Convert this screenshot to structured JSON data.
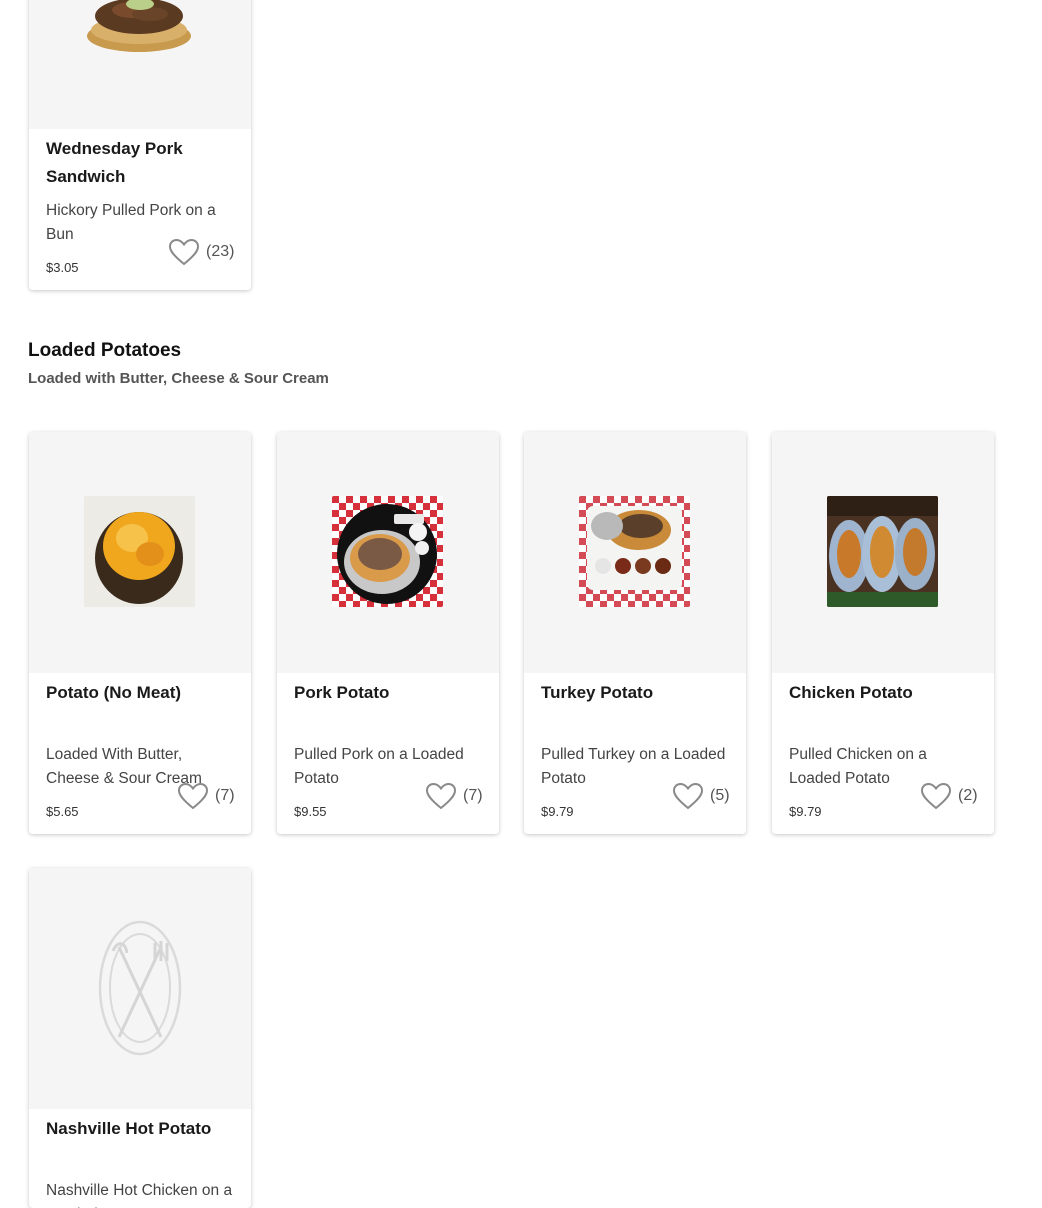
{
  "top_item": {
    "name": "Wednesday Pork Sandwich",
    "description": "Hickory Pulled Pork on a Bun",
    "price": "$3.05",
    "favorites": "(23)"
  },
  "section": {
    "title": "Loaded Potatoes",
    "subtitle": "Loaded with Butter, Cheese & Sour Cream"
  },
  "items": [
    {
      "name": "Potato (No Meat)",
      "description": "Loaded With Butter, Cheese & Sour Cream",
      "price": "$5.65",
      "favorites": "(7)"
    },
    {
      "name": "Pork Potato",
      "description": "Pulled Pork on a Loaded Potato",
      "price": "$9.55",
      "favorites": "(7)"
    },
    {
      "name": "Turkey Potato",
      "description": "Pulled Turkey on a Loaded Potato",
      "price": "$9.79",
      "favorites": "(5)"
    },
    {
      "name": "Chicken Potato",
      "description": "Pulled Chicken on a Loaded Potato",
      "price": "$9.79",
      "favorites": "(2)"
    },
    {
      "name": "Nashville Hot Potato",
      "description": "Nashville Hot Chicken on a Loaded Potato"
    }
  ],
  "icons": {
    "favorite": "heart-outline-icon",
    "placeholder": "fork-knife-plate-icon"
  },
  "colors": {
    "card_image_bg": "#f5f5f5",
    "heart_stroke": "#8a8a8a"
  }
}
